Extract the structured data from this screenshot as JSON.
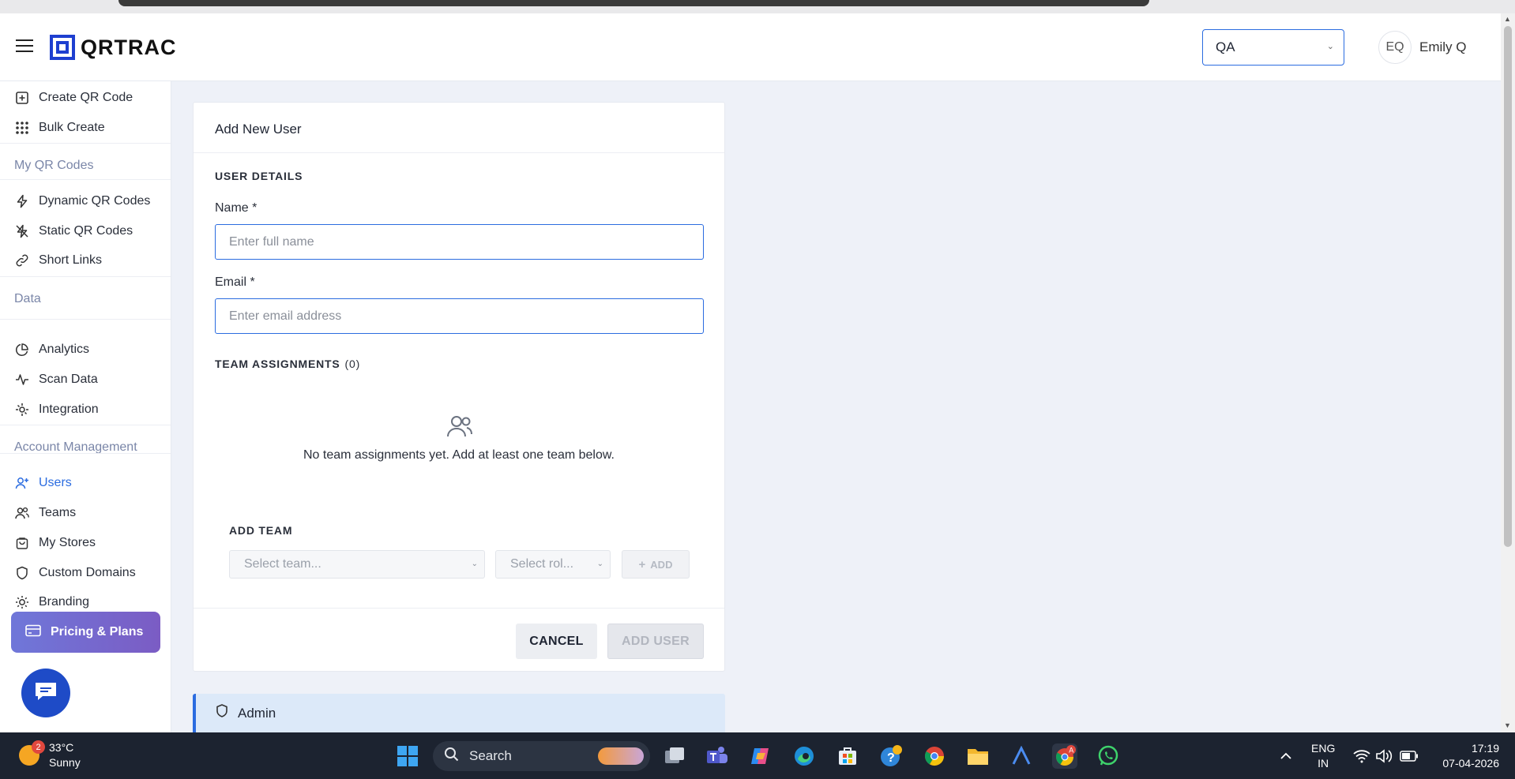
{
  "header": {
    "logo_text": "QRTRAC",
    "org_select_value": "QA",
    "avatar_initials": "EQ",
    "user_name": "Emily Q"
  },
  "sidebar": {
    "items_top": [
      {
        "label": "Create QR Code",
        "icon": "plus-square-icon"
      },
      {
        "label": "Bulk Create",
        "icon": "grid-dots-icon"
      }
    ],
    "sections": {
      "my_qr_codes": "My QR Codes",
      "data": "Data",
      "account_management": "Account Management"
    },
    "items_qr": [
      {
        "label": "Dynamic QR Codes",
        "icon": "lightning-icon"
      },
      {
        "label": "Static QR Codes",
        "icon": "lightning-off-icon"
      },
      {
        "label": "Short Links",
        "icon": "link-icon"
      }
    ],
    "items_data": [
      {
        "label": "Analytics",
        "icon": "pie-chart-icon"
      },
      {
        "label": "Scan Data",
        "icon": "activity-icon"
      },
      {
        "label": "Integration",
        "icon": "plug-icon"
      }
    ],
    "items_account": [
      {
        "label": "Users",
        "icon": "user-plus-icon",
        "active": true
      },
      {
        "label": "Teams",
        "icon": "users-icon"
      },
      {
        "label": "My Stores",
        "icon": "shopping-bag-icon"
      },
      {
        "label": "Custom Domains",
        "icon": "shield-icon"
      },
      {
        "label": "Branding",
        "icon": "sun-icon"
      }
    ],
    "pricing_label": "Pricing & Plans"
  },
  "form": {
    "title": "Add New User",
    "user_details_label": "USER DETAILS",
    "name_label": "Name *",
    "name_placeholder": "Enter full name",
    "email_label": "Email *",
    "email_placeholder": "Enter email address",
    "team_assignments_label": "TEAM ASSIGNMENTS",
    "team_assignments_count": "(0)",
    "empty_message": "No team assignments yet. Add at least one team below.",
    "add_team_label": "ADD TEAM",
    "select_team_placeholder": "Select team...",
    "select_role_placeholder": "Select rol...",
    "add_button": "ADD",
    "cancel_button": "CANCEL",
    "add_user_button": "ADD USER"
  },
  "admin_section": {
    "label": "Admin"
  },
  "taskbar": {
    "weather_temp": "33°C",
    "weather_desc": "Sunny",
    "weather_badge": "2",
    "search_label": "Search",
    "lang_top": "ENG",
    "lang_bottom": "IN",
    "time": "17:19",
    "date": "07-04-2026"
  },
  "colors": {
    "accent": "#2b6ce0",
    "pricing_gradient_start": "#6f77d9",
    "pricing_gradient_end": "#7b5cc4",
    "chat_button": "#1e4bc7",
    "taskbar": "#1c2330"
  }
}
